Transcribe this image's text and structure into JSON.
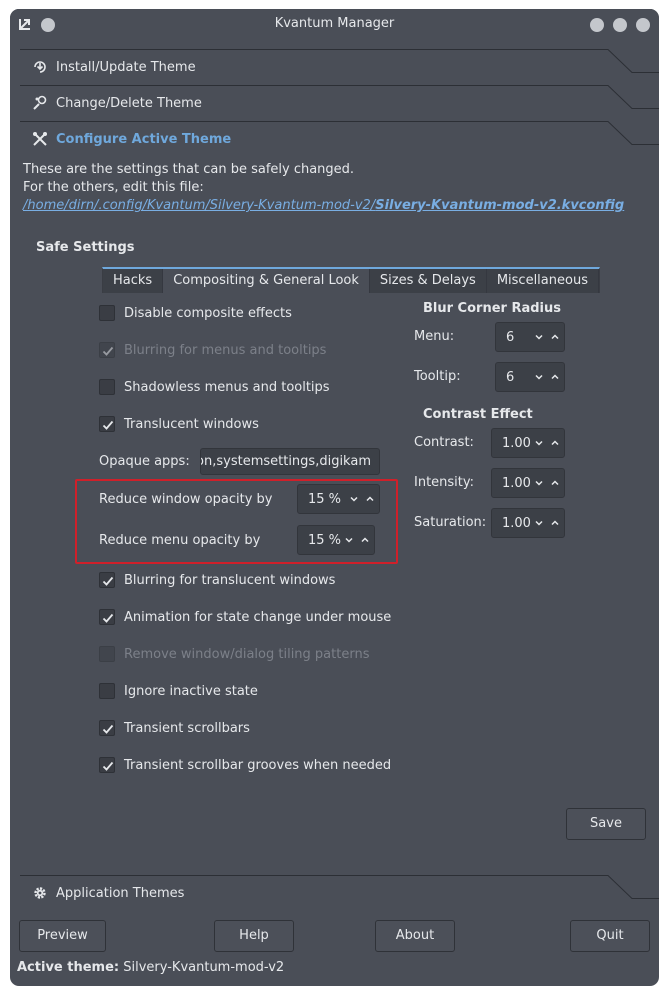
{
  "window": {
    "title": "Kvantum Manager"
  },
  "sections": {
    "install": "Install/Update Theme",
    "change": "Change/Delete Theme",
    "configure": "Configure Active Theme",
    "app_themes": "Application Themes"
  },
  "info": {
    "line1": "These are the settings that can be safely changed.",
    "line2": "For the others, edit this file:",
    "path_dir": "/home/dirn/.config/Kvantum/Silvery-Kvantum-mod-v2/",
    "path_file": "Silvery-Kvantum-mod-v2.kvconfig"
  },
  "safe_settings": "Safe Settings",
  "tabs": [
    "Hacks",
    "Compositing & General Look",
    "Sizes & Delays",
    "Miscellaneous"
  ],
  "checks": {
    "disable_composite": "Disable composite effects",
    "blurring_menus": "Blurring for menus and tooltips",
    "shadowless": "Shadowless menus and tooltips",
    "translucent": "Translucent windows",
    "blurring_translucent": "Blurring for translucent windows",
    "animation": "Animation for state change under mouse",
    "remove_tiling": "Remove window/dialog tiling patterns",
    "ignore_inactive": "Ignore inactive state",
    "transient_scrollbars": "Transient scrollbars",
    "transient_grooves": "Transient scrollbar grooves when needed"
  },
  "opaque": {
    "label": "Opaque apps:",
    "value": "on,systemsettings,digikam"
  },
  "reduce_window": {
    "label": "Reduce window opacity by",
    "value": "15 %"
  },
  "reduce_menu": {
    "label": "Reduce menu opacity by",
    "value": "15 %"
  },
  "blur_corner": {
    "title": "Blur Corner Radius",
    "menu_label": "Menu:",
    "menu_value": "6",
    "tooltip_label": "Tooltip:",
    "tooltip_value": "6"
  },
  "contrast_effect": {
    "title": "Contrast Effect",
    "contrast_label": "Contrast:",
    "contrast_value": "1.00",
    "intensity_label": "Intensity:",
    "intensity_value": "1.00",
    "saturation_label": "Saturation:",
    "saturation_value": "1.00"
  },
  "buttons": {
    "save": "Save",
    "preview": "Preview",
    "help": "Help",
    "about": "About",
    "quit": "Quit"
  },
  "status": {
    "label": "Active theme:",
    "value": "Silvery-Kvantum-mod-v2"
  },
  "colors": {
    "background": "#4a4e57",
    "accent": "#6fa8dc",
    "link": "#79aee3",
    "highlight": "#d0202a"
  }
}
